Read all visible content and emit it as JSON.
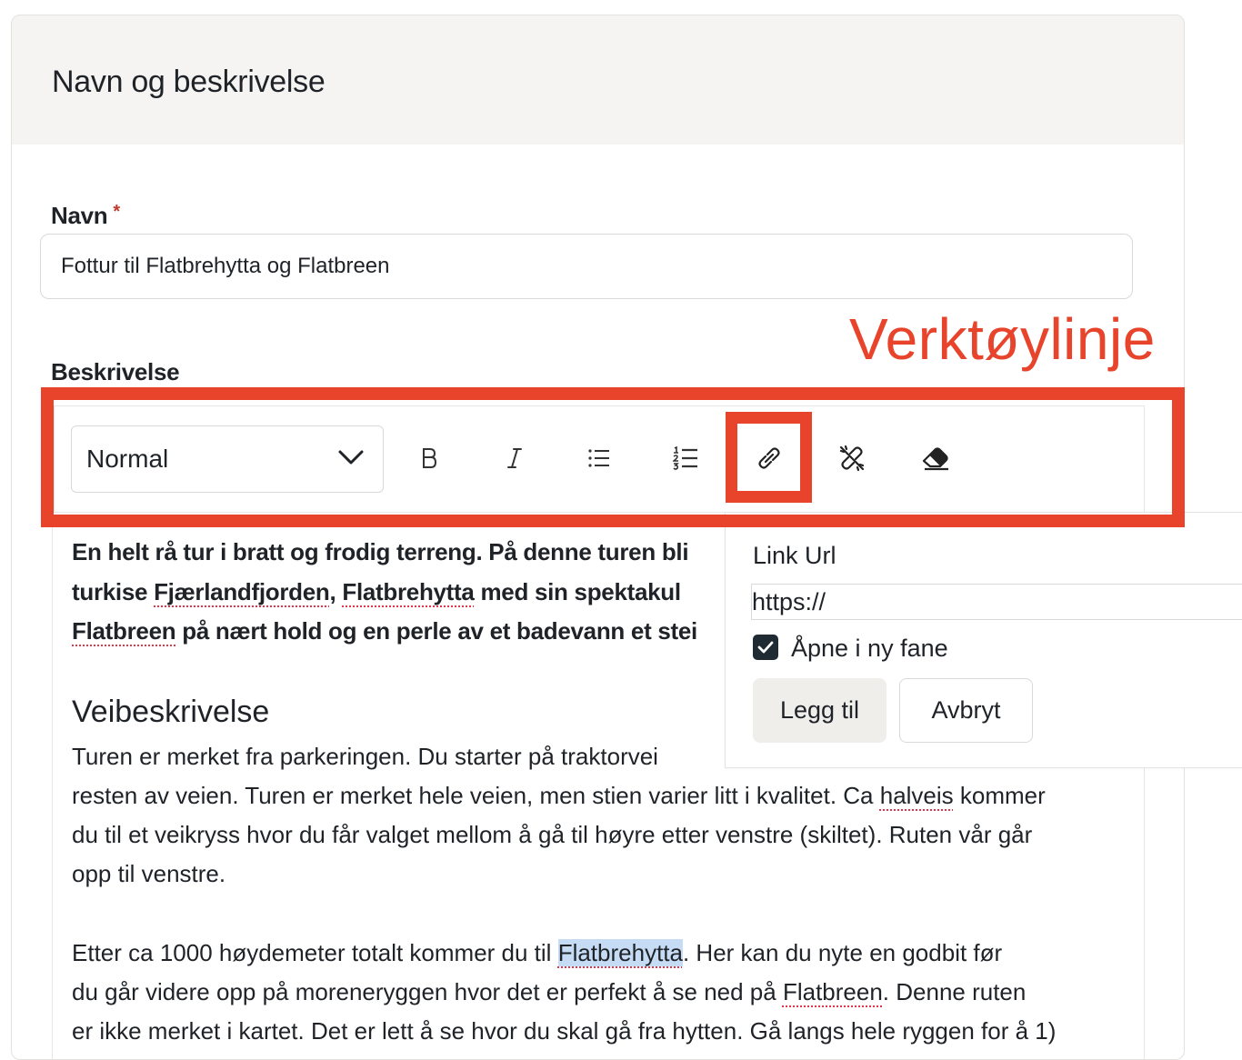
{
  "section": {
    "title": "Navn og beskrivelse"
  },
  "name_field": {
    "label": "Navn",
    "required_mark": "*",
    "value": "Fottur til Flatbrehytta og Flatbreen"
  },
  "description": {
    "label": "Beskrivelse"
  },
  "annotation": {
    "caption": "Verktøylinje",
    "color": "#e8432b"
  },
  "toolbar": {
    "format_select": "Normal",
    "buttons": [
      "bold-icon",
      "italic-icon",
      "bullet-list-icon",
      "numbered-list-icon",
      "link-icon",
      "unlink-icon",
      "eraser-icon"
    ]
  },
  "editor": {
    "intro_lines": [
      "En helt rå tur i bratt og frodig terreng. På denne turen bli",
      [
        "turkise ",
        "Fjærlandfjorden",
        ", ",
        "Flatbrehytta",
        " med sin spektakul"
      ],
      [
        "Flatbreen",
        " på nært hold og en perle av et badevann et stei"
      ]
    ],
    "heading": "Veibeskrivelse",
    "para1_lines": [
      "Turen er merket fra parkeringen. Du starter på traktorvei",
      [
        "resten av veien. Turen er merket hele veien, men stien varier litt i kvalitet. Ca ",
        "halveis",
        " kommer"
      ],
      "du til et veikryss hvor du får valget mellom å gå til høyre etter venstre (skiltet). Ruten vår går",
      "opp til venstre."
    ],
    "para2_lines": [
      [
        "Etter ca 1000 høydemeter totalt kommer du til ",
        "Flatbrehytta",
        ". Her kan du nyte en godbit før"
      ],
      [
        "du går videre opp på moreneryggen hvor det er perfekt å se ned på ",
        "Flatbreen",
        ". Denne ruten"
      ],
      "er ikke merket i kartet. Det er lett å se hvor du skal gå fra hytten. Gå langs hele ryggen for å 1)"
    ]
  },
  "link_popover": {
    "label": "Link Url",
    "url_value": "https://",
    "open_new_tab_label": "Åpne i ny fane",
    "open_new_tab_checked": true,
    "add_label": "Legg til",
    "cancel_label": "Avbryt"
  }
}
